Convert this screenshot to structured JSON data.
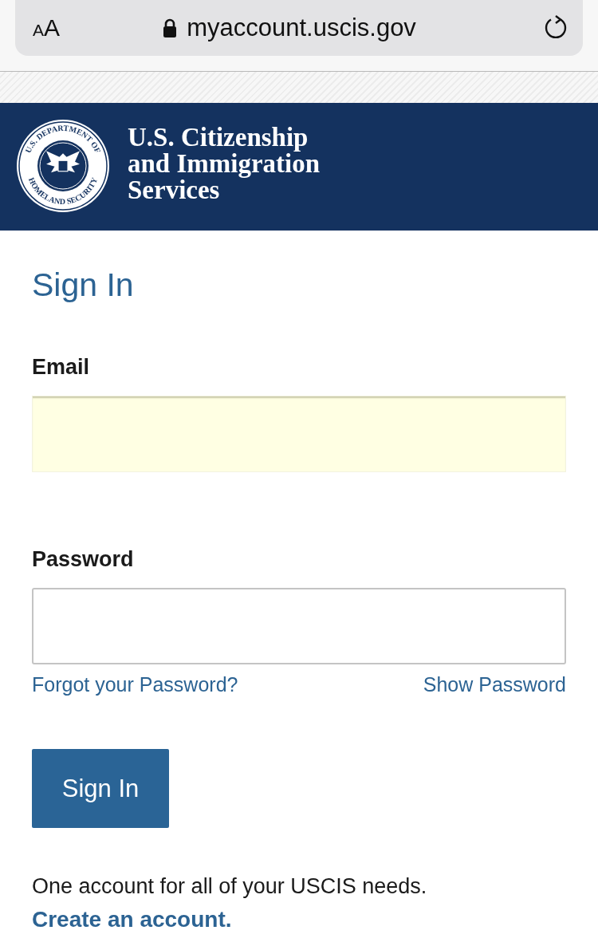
{
  "browser": {
    "text_size": [
      "A",
      "A"
    ],
    "url": "myaccount.uscis.gov"
  },
  "header": {
    "seal_top": "U.S. DEPARTMENT OF",
    "seal_bottom": "HOMELAND SECURITY",
    "agency_lines": [
      "U.S. Citizenship",
      "and Immigration",
      "Services"
    ]
  },
  "form": {
    "title": "Sign In",
    "fields": [
      {
        "label": "Email",
        "autofilled": true
      },
      {
        "label": "Password",
        "autofilled": false
      }
    ],
    "forgot_link": "Forgot your Password?",
    "show_password_link": "Show Password",
    "submit": "Sign In",
    "note": "One account for all of your USCIS needs.",
    "create_link": "Create an account."
  }
}
